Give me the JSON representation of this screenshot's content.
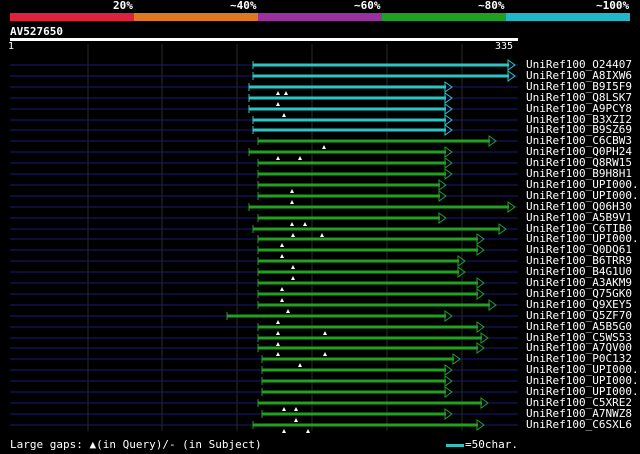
{
  "header": {
    "percent_labels": [
      "20%",
      "~40%",
      "~60%",
      "~80%",
      "~100%"
    ],
    "color_scale": [
      "#e0203c",
      "#e07820",
      "#9b30a0",
      "#20a020",
      "#20b8c8"
    ]
  },
  "query": {
    "name": "AV527650",
    "start": "1",
    "end": "335"
  },
  "colors": {
    "background": "#000000",
    "cyan": "#2ec4c4",
    "green": "#22a022",
    "query_line": "#1a1a7a",
    "gridline": "#2a2a2a"
  },
  "hits": [
    {
      "label": "UniRef100_O24407",
      "color": "cyan"
    },
    {
      "label": "UniRef100_A8IXW6",
      "color": "cyan"
    },
    {
      "label": "UniRef100_B9I5F9",
      "color": "cyan"
    },
    {
      "label": "UniRef100_Q8LSK7",
      "color": "cyan"
    },
    {
      "label": "UniRef100_A9PCY8",
      "color": "cyan"
    },
    {
      "label": "UniRef100_B3XZI2",
      "color": "cyan"
    },
    {
      "label": "UniRef100_B9SZ69",
      "color": "cyan"
    },
    {
      "label": "UniRef100_C6CBW3",
      "color": "green"
    },
    {
      "label": "UniRef100_Q0PH24",
      "color": "green"
    },
    {
      "label": "UniRef100_Q8RW15",
      "color": "green"
    },
    {
      "label": "UniRef100_B9H8H1",
      "color": "green"
    },
    {
      "label": "UniRef100_UPI000..",
      "color": "green"
    },
    {
      "label": "UniRef100_UPI000..",
      "color": "green"
    },
    {
      "label": "UniRef100_Q06H30",
      "color": "green"
    },
    {
      "label": "UniRef100_A5B9V1",
      "color": "green"
    },
    {
      "label": "UniRef100_C6TIB0",
      "color": "green"
    },
    {
      "label": "UniRef100_UPI000..",
      "color": "green"
    },
    {
      "label": "UniRef100_Q0DQ61",
      "color": "green"
    },
    {
      "label": "UniRef100_B6TRR9",
      "color": "green"
    },
    {
      "label": "UniRef100_B4G1U0",
      "color": "green"
    },
    {
      "label": "UniRef100_A3AKM9",
      "color": "green"
    },
    {
      "label": "UniRef100_Q75GK0",
      "color": "green"
    },
    {
      "label": "UniRef100_Q9XEY5",
      "color": "green"
    },
    {
      "label": "UniRef100_Q5ZF70",
      "color": "green"
    },
    {
      "label": "UniRef100_A5B5G0",
      "color": "green"
    },
    {
      "label": "UniRef100_C5WS53",
      "color": "green"
    },
    {
      "label": "UniRef100_A7QV00",
      "color": "green"
    },
    {
      "label": "UniRef100_P0C132",
      "color": "green"
    },
    {
      "label": "UniRef100_UPI000..",
      "color": "green"
    },
    {
      "label": "UniRef100_UPI000..",
      "color": "green"
    },
    {
      "label": "UniRef100_UPI000..",
      "color": "green"
    },
    {
      "label": "UniRef100_C5XRE2",
      "color": "green"
    },
    {
      "label": "UniRef100_A7NWZ8",
      "color": "green"
    },
    {
      "label": "UniRef100_C6SXL6",
      "color": "green"
    }
  ],
  "legend": {
    "gaps_text": "Large gaps: ▲(in Query)/- (in Subject)",
    "scale_text": "=50char."
  }
}
